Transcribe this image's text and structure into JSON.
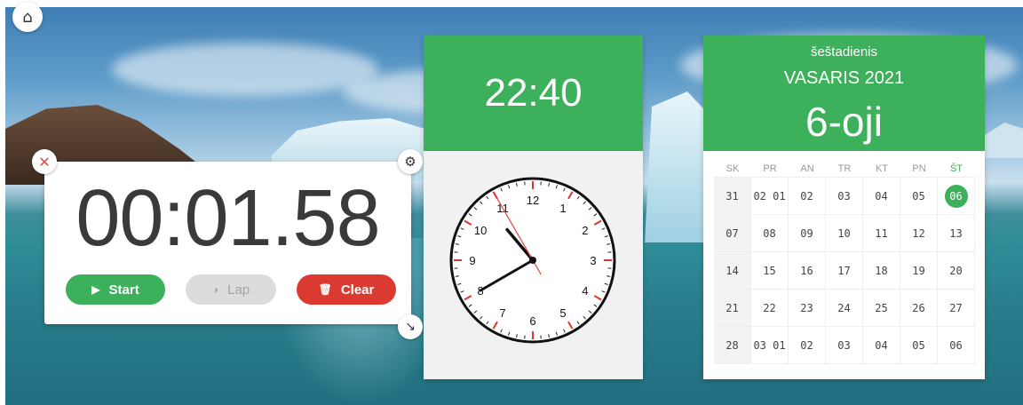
{
  "home_icon": "home-icon",
  "stopwatch": {
    "time": "00:01.58",
    "start_label": "Start",
    "lap_label": "Lap",
    "clear_label": "Clear",
    "icons": [
      "close-icon",
      "gear-icon",
      "resize-icon",
      "play-icon",
      "lap-icon",
      "trash-icon"
    ]
  },
  "clock": {
    "digital_time": "22:40",
    "analog": {
      "hour": 10,
      "minute": 40,
      "second": 55
    },
    "numbers": [
      "12",
      "1",
      "2",
      "3",
      "4",
      "5",
      "6",
      "7",
      "8",
      "9",
      "10",
      "11"
    ]
  },
  "calendar": {
    "weekday": "šeštadienis",
    "month_year": "VASARIS 2021",
    "day": "6-oji",
    "headers": [
      "SK",
      "PR",
      "AN",
      "TR",
      "KT",
      "PN",
      "ŠT"
    ],
    "today_col": 6,
    "rows": [
      [
        "31",
        "02 01",
        "02",
        "03",
        "04",
        "05",
        "06"
      ],
      [
        "07",
        "08",
        "09",
        "10",
        "11",
        "12",
        "13"
      ],
      [
        "14",
        "15",
        "16",
        "17",
        "18",
        "19",
        "20"
      ],
      [
        "21",
        "22",
        "23",
        "24",
        "25",
        "26",
        "27"
      ],
      [
        "28",
        "03 01",
        "02",
        "03",
        "04",
        "05",
        "06"
      ]
    ],
    "today": {
      "row": 0,
      "col": 6
    }
  },
  "colors": {
    "accent_green": "#3cb05a",
    "clear_red": "#db3a30",
    "second_hand": "#e0473d"
  }
}
